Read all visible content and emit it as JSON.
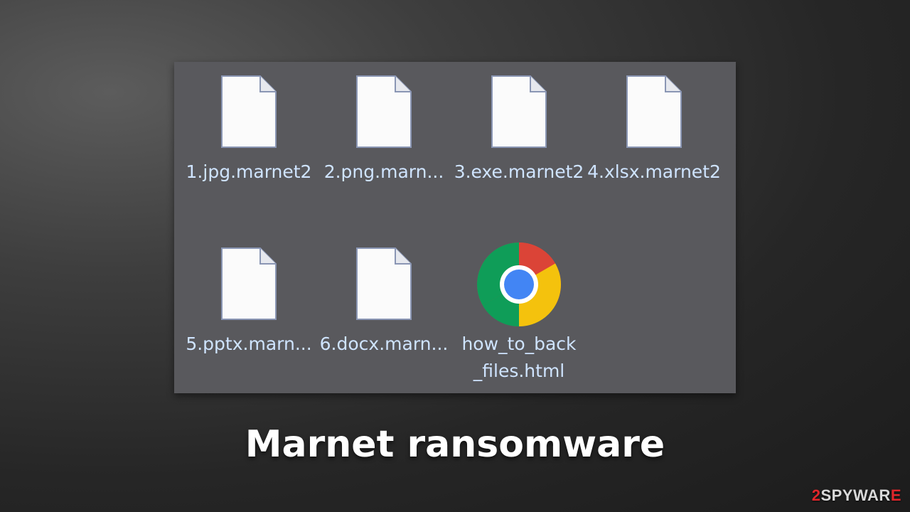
{
  "explorer": {
    "files": [
      {
        "name": "1.jpg.marnet2",
        "icon": "blank-document-icon"
      },
      {
        "name": "2.png.marn...",
        "icon": "blank-document-icon"
      },
      {
        "name": "3.exe.marnet2",
        "icon": "blank-document-icon"
      },
      {
        "name": "4.xlsx.marnet2",
        "icon": "blank-document-icon"
      },
      {
        "name": "5.pptx.marn...",
        "icon": "blank-document-icon"
      },
      {
        "name": "6.docx.marn...",
        "icon": "blank-document-icon"
      },
      {
        "name": "how_to_back_files.html",
        "icon": "chrome-browser-icon"
      }
    ],
    "label_color": "#cfe4ff",
    "panel_color": "#59595d"
  },
  "caption": {
    "title": "Marnet ransomware"
  },
  "watermark": {
    "prefix": "2",
    "middle": "SPYWAR",
    "suffix": "E"
  }
}
